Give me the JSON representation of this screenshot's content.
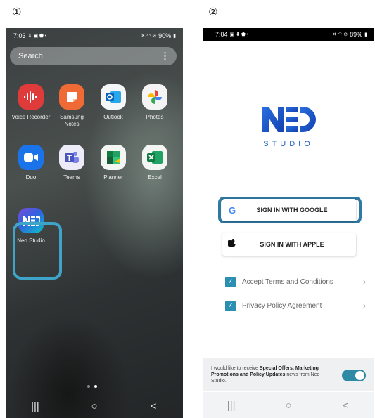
{
  "steps": {
    "first": "①",
    "second": "②"
  },
  "phone1": {
    "status": {
      "time": "7:03",
      "left_icons": "⬇ ▣ ⬟ •",
      "right_icons": "✕ ◠ ⊘",
      "battery": "90%"
    },
    "search": {
      "placeholder": "Search",
      "menu_glyph": "⋮"
    },
    "apps": [
      {
        "label": "Voice Recorder",
        "icon": "voice-recorder-icon"
      },
      {
        "label": "Samsung Notes",
        "icon": "samsung-notes-icon"
      },
      {
        "label": "Outlook",
        "icon": "outlook-icon"
      },
      {
        "label": "Photos",
        "icon": "photos-icon"
      },
      {
        "label": "Duo",
        "icon": "duo-icon"
      },
      {
        "label": "Teams",
        "icon": "teams-icon"
      },
      {
        "label": "Planner",
        "icon": "planner-icon"
      },
      {
        "label": "Excel",
        "icon": "excel-icon"
      },
      {
        "label": "Neo Studio",
        "icon": "neo-studio-icon"
      }
    ],
    "nav": {
      "recents": "|||",
      "home": "○",
      "back": "<"
    }
  },
  "phone2": {
    "status": {
      "time": "7:04",
      "left_icons": "▣ ⬇ ⬟ •",
      "right_icons": "✕ ◠ ⊘",
      "battery": "89%"
    },
    "logo": {
      "subtitle": "STUDIO"
    },
    "google_button": {
      "label": "SIGN IN WITH GOOGLE",
      "icon_glyph": "G"
    },
    "apple_button": {
      "label": "SIGN IN WITH APPLE",
      "icon_glyph": ""
    },
    "terms": {
      "label": "Accept Terms and Conditions",
      "checked": true
    },
    "privacy": {
      "label": "Privacy Policy Agreement",
      "checked": true
    },
    "offers": {
      "prefix": "I would like to receive ",
      "bold": "Special Offers, Marketing Promotions and Policy Updates",
      "suffix": " news from Neo Studio.",
      "toggle_on": true
    },
    "nav": {
      "recents": "|||",
      "home": "○",
      "back": "<"
    }
  },
  "colors": {
    "highlight": "#3fa4c9",
    "checkbox": "#2a8fb0",
    "brand_blue": "#1d5fc2"
  }
}
